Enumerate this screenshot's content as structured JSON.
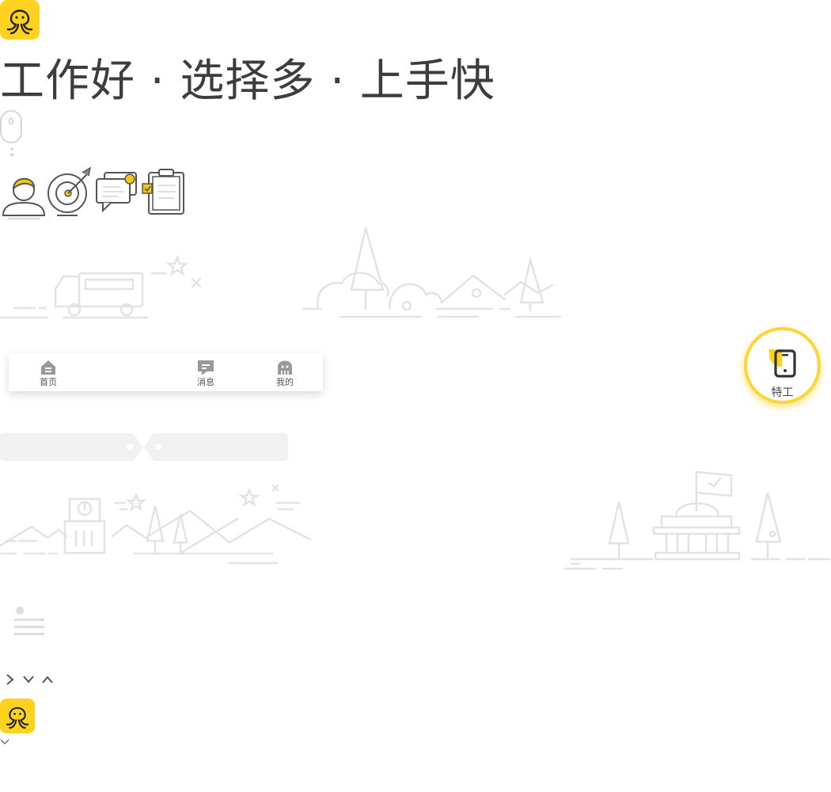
{
  "slogan": "工作好 · 选择多 · 上手快",
  "scroll_indicator": {
    "value": "0"
  },
  "tabbar": {
    "home": "首页",
    "messages": "消息",
    "mine": "我的"
  },
  "agent_button": {
    "label": "特工"
  },
  "colors": {
    "brand_yellow": "#ffd21f",
    "line_gray": "#e3e3e3",
    "text_dark": "#3d3d3d"
  },
  "icons": [
    "octopus-logo",
    "worker-avatar",
    "target",
    "chat-bubbles",
    "clipboard-check",
    "home-icon",
    "message-icon",
    "mine-icon",
    "phone-icon",
    "chevron-right-icon",
    "chevron-down-icon",
    "chevron-up-icon"
  ]
}
